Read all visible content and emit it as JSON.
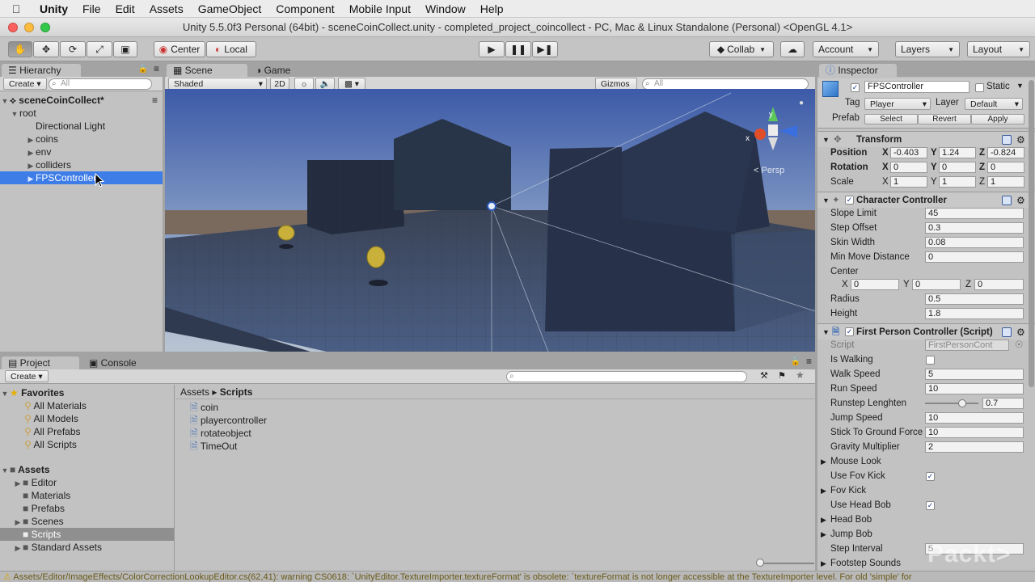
{
  "menubar": {
    "app": "Unity",
    "items": [
      "File",
      "Edit",
      "Assets",
      "GameObject",
      "Component",
      "Mobile Input",
      "Window",
      "Help"
    ]
  },
  "window": {
    "title": "Unity 5.5.0f3 Personal (64bit) - sceneCoinCollect.unity - completed_project_coincollect - PC, Mac & Linux Standalone (Personal) <OpenGL 4.1>"
  },
  "toolbar": {
    "pivot": "Center",
    "space": "Local",
    "collab": "Collab",
    "account": "Account",
    "layers": "Layers",
    "layout": "Layout"
  },
  "hierarchy": {
    "tab": "Hierarchy",
    "create": "Create",
    "search_placeholder": "All",
    "scene": "sceneCoinCollect*",
    "items": [
      {
        "label": "root",
        "indent": 1,
        "expandable": true
      },
      {
        "label": "Directional Light",
        "indent": 2,
        "expandable": false
      },
      {
        "label": "coins",
        "indent": 2,
        "expandable": true
      },
      {
        "label": "env",
        "indent": 2,
        "expandable": true
      },
      {
        "label": "colliders",
        "indent": 2,
        "expandable": true
      },
      {
        "label": "FPSController",
        "indent": 2,
        "expandable": true
      }
    ]
  },
  "scene": {
    "tab_scene": "Scene",
    "tab_game": "Game",
    "shading": "Shaded",
    "mode_2d": "2D",
    "gizmos": "Gizmos",
    "search_placeholder": "All",
    "persp_label": "< Persp"
  },
  "project": {
    "tab_project": "Project",
    "tab_console": "Console",
    "create": "Create",
    "favorites_label": "Favorites",
    "favorites": [
      "All Materials",
      "All Models",
      "All Prefabs",
      "All Scripts"
    ],
    "assets_label": "Assets",
    "assets": [
      {
        "label": "Editor",
        "expandable": true
      },
      {
        "label": "Materials",
        "expandable": false
      },
      {
        "label": "Prefabs",
        "expandable": false
      },
      {
        "label": "Scenes",
        "expandable": true
      },
      {
        "label": "Scripts",
        "expandable": false
      },
      {
        "label": "Standard Assets",
        "expandable": true
      }
    ],
    "breadcrumb_root": "Assets",
    "breadcrumb_current": "Scripts",
    "files": [
      "coin",
      "playercontroller",
      "rotateobject",
      "TimeOut"
    ]
  },
  "inspector": {
    "tab": "Inspector",
    "object_name": "FPSController",
    "static_label": "Static",
    "tag_label": "Tag",
    "tag_value": "Player",
    "layer_label": "Layer",
    "layer_value": "Default",
    "prefab_label": "Prefab",
    "prefab_select": "Select",
    "prefab_revert": "Revert",
    "prefab_apply": "Apply",
    "transform": {
      "title": "Transform",
      "position_label": "Position",
      "rotation_label": "Rotation",
      "scale_label": "Scale",
      "position": [
        "-0.403",
        "1.24",
        "-0.824"
      ],
      "rotation": [
        "0",
        "0",
        "0"
      ],
      "scale": [
        "1",
        "1",
        "1"
      ]
    },
    "character_controller": {
      "title": "Character Controller",
      "rows": [
        {
          "label": "Slope Limit",
          "value": "45"
        },
        {
          "label": "Step Offset",
          "value": "0.3"
        },
        {
          "label": "Skin Width",
          "value": "0.08"
        },
        {
          "label": "Min Move Distance",
          "value": "0"
        }
      ],
      "center_label": "Center",
      "center": [
        "0",
        "0",
        "0"
      ],
      "radius_label": "Radius",
      "radius": "0.5",
      "height_label": "Height",
      "height": "1.8"
    },
    "fps_script": {
      "title": "First Person Controller (Script)",
      "script_label": "Script",
      "script_value": "FirstPersonCont",
      "is_walking_label": "Is Walking",
      "walk_speed_label": "Walk Speed",
      "walk_speed": "5",
      "run_speed_label": "Run Speed",
      "run_speed": "10",
      "runstep_label": "Runstep Lenghten",
      "runstep_value": "0.7",
      "runstep_fraction": 0.7,
      "jump_speed_label": "Jump Speed",
      "jump_speed": "10",
      "stick_label": "Stick To Ground Force",
      "stick_value": "10",
      "gravity_label": "Gravity Multiplier",
      "gravity_value": "2",
      "mouse_look_label": "Mouse Look",
      "use_fov_kick_label": "Use Fov Kick",
      "fov_kick_label": "Fov Kick",
      "use_head_bob_label": "Use Head Bob",
      "head_bob_label": "Head Bob",
      "jump_bob_label": "Jump Bob",
      "step_interval_label": "Step Interval",
      "step_interval": "5",
      "footstep_label": "Footstep Sounds"
    }
  },
  "watermark": "Packt>",
  "status": "Assets/Editor/ImageEffects/ColorCorrectionLookupEditor.cs(62,41): warning CS0618: `UnityEditor.TextureImporter.textureFormat' is obsolete: `textureFormat is not longer accessible at the TextureImporter level. For old 'simple' for"
}
